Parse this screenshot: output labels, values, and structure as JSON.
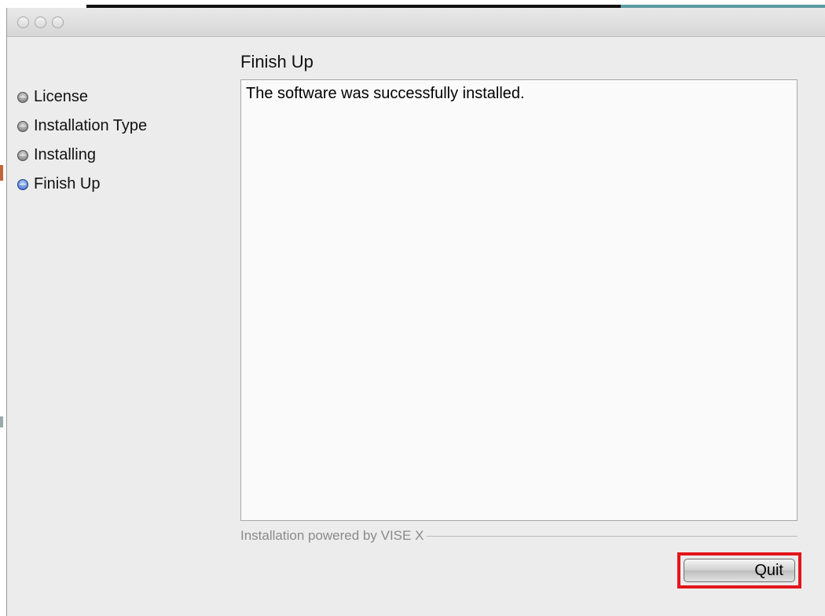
{
  "window": {
    "controls": [
      "close-button",
      "minimize-button",
      "zoom-button"
    ]
  },
  "sidebar": {
    "steps": [
      {
        "label": "License",
        "active": false
      },
      {
        "label": "Installation Type",
        "active": false
      },
      {
        "label": "Installing",
        "active": false
      },
      {
        "label": "Finish Up",
        "active": true
      }
    ]
  },
  "main": {
    "title": "Finish Up",
    "message": "The software was successfully installed."
  },
  "footer": {
    "powered_by": "Installation powered by VISE X"
  },
  "buttons": {
    "quit_label": "Quit"
  },
  "colors": {
    "highlight": "#e3161c",
    "active_step": "#2f5fc2"
  }
}
